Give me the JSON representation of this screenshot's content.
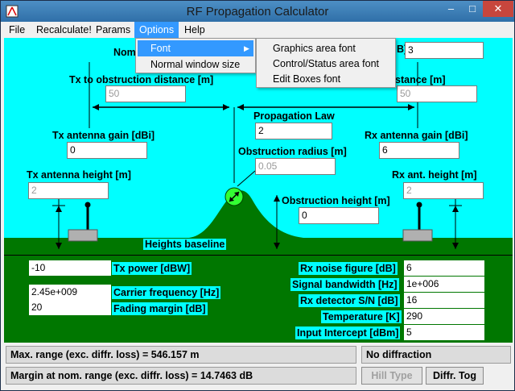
{
  "window": {
    "title": "RF Propagation Calculator",
    "controls": {
      "minimize": "–",
      "maximize": "□",
      "close": "✕"
    }
  },
  "menubar": {
    "items": [
      "File",
      "Recalculate!",
      "Params",
      "Options",
      "Help"
    ],
    "active": "Options"
  },
  "options_menu": {
    "items": [
      "Font",
      "Normal window size"
    ],
    "font_arrow": "▶"
  },
  "font_submenu": {
    "items": [
      "Graphics area font",
      "Control/Status area font",
      "Edit Boxes font"
    ]
  },
  "diagram": {
    "nominal_range_label_partial": "Nom",
    "nominal_range_suffix": "B]",
    "nominal_range_value": "3",
    "tx_obstruction_label": "Tx to obstruction distance [m]",
    "tx_obstruction_value": "50",
    "rx_obstruction_label_partial": "stance [m]",
    "rx_obstruction_value": "50",
    "propagation_law_label": "Propagation Law",
    "propagation_law_value": "2",
    "tx_gain_label": "Tx antenna gain [dBi]",
    "tx_gain_value": "0",
    "rx_gain_label": "Rx antenna gain [dBi]",
    "rx_gain_value": "6",
    "obstruction_radius_label": "Obstruction radius [m]",
    "obstruction_radius_value": "0.05",
    "tx_height_label": "Tx antenna height [m]",
    "tx_height_value": "2",
    "rx_height_label": "Rx ant. height [m]",
    "rx_height_value": "2",
    "obstruction_height_label": "Obstruction height [m]",
    "obstruction_height_value": "0",
    "heights_baseline_label": "Heights baseline",
    "colors": {
      "sky": "#00ffff",
      "ground": "#007700",
      "obstruction_marker": "#33ff33"
    }
  },
  "params": {
    "tx_power_label": "Tx power [dBW]",
    "tx_power_value": "-10",
    "carrier_freq_label": "Carrier frequency [Hz]",
    "carrier_freq_value": "2.45e+009",
    "fading_margin_label": "Fading margin [dB]",
    "fading_margin_value": "20",
    "rx_noise_label": "Rx noise figure [dB]",
    "rx_noise_value": "6",
    "signal_bw_label": "Signal bandwidth [Hz]",
    "signal_bw_value": "1e+006",
    "rx_sn_label": "Rx detector S/N [dB]",
    "rx_sn_value": "16",
    "temperature_label": "Temperature [K]",
    "temperature_value": "290",
    "input_intercept_label": "Input Intercept [dBm]",
    "input_intercept_value": "5"
  },
  "status": {
    "max_range": "Max. range (exc. diffr. loss) =      546.157 m",
    "diffraction": "No diffraction",
    "margin": "Margin at nom. range (exc. diffr. loss) =     14.7463 dB",
    "hill_type_button": "Hill Type",
    "diffr_tog_button": "Diffr. Tog"
  }
}
